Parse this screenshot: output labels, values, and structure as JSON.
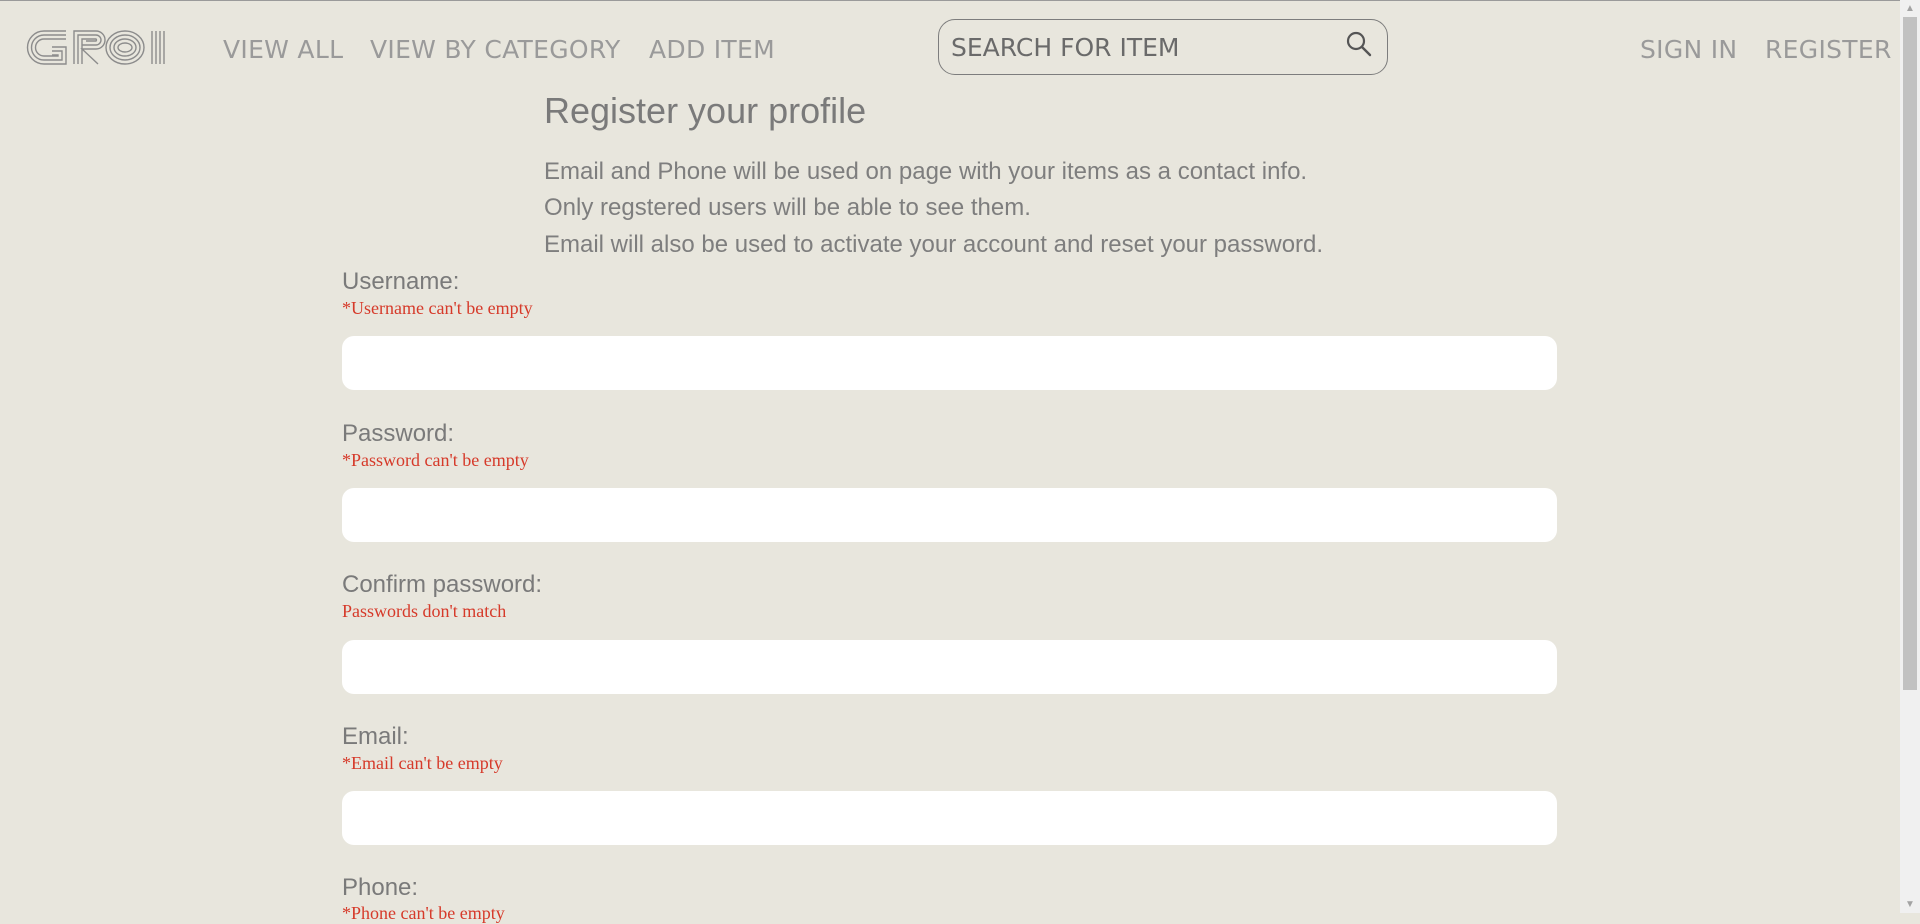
{
  "header": {
    "logo_text": "GROI",
    "nav": {
      "view_all": "VIEW ALL",
      "view_by_category": "VIEW BY CATEGORY",
      "add_item": "ADD ITEM"
    },
    "search": {
      "placeholder": "SEARCH FOR ITEM",
      "icon": "search-icon"
    },
    "auth": {
      "sign_in": "SIGN IN",
      "register": "REGISTER"
    }
  },
  "main": {
    "title": "Register your profile",
    "intro": [
      "Email and Phone will be used on page with your items as a contact info.",
      "Only regstered users will be able to see them.",
      "Email will also be used to activate your account and reset your password."
    ],
    "fields": [
      {
        "label": "Username:",
        "error": "*Username can't be empty",
        "value": ""
      },
      {
        "label": "Password:",
        "error": "*Password can't be empty",
        "value": ""
      },
      {
        "label": "Confirm password:",
        "error": "Passwords don't match",
        "value": ""
      },
      {
        "label": "Email:",
        "error": "*Email can't be empty",
        "value": ""
      },
      {
        "label": "Phone:",
        "error": "*Phone can't be empty",
        "value": ""
      }
    ]
  },
  "colors": {
    "background": "#e8e6dd",
    "error": "#d63a2a",
    "text": "#7a7a7a",
    "input_bg": "#ffffff"
  }
}
